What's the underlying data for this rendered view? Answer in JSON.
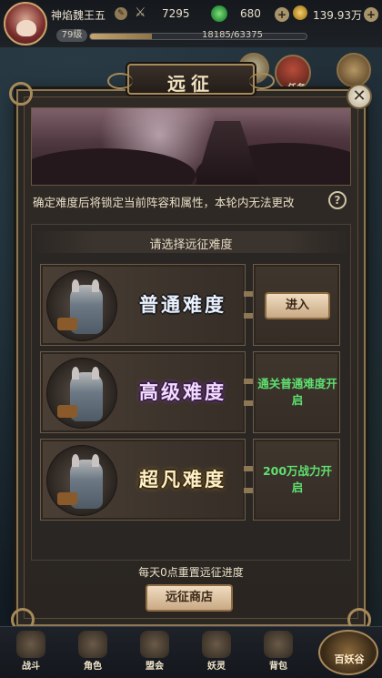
{
  "player": {
    "name": "神焰魏王五",
    "power": "7295",
    "jade": "680",
    "coins": "139.93万",
    "level": "79级",
    "exp_text": "18185/63375",
    "exp_fraction": 0.287
  },
  "side": {
    "quest_label": "任务"
  },
  "modal": {
    "title": "远征",
    "notice": "确定难度后将锁定当前阵容和属性，本轮内无法更改",
    "help": "?",
    "select_title": "请选择远征难度",
    "difficulties": [
      {
        "name": "普通难度",
        "action_label": "进入",
        "locked_text": ""
      },
      {
        "name": "高级难度",
        "action_label": "",
        "locked_text": "通关普通难度开启"
      },
      {
        "name": "超凡难度",
        "action_label": "",
        "locked_text": "200万战力开启"
      }
    ],
    "reset_text": "每天0点重置远征进度",
    "shop_label": "远征商店"
  },
  "nav": {
    "items": [
      "战斗",
      "角色",
      "盟会",
      "妖灵",
      "背包"
    ],
    "big_label": "百妖谷"
  },
  "colors": {
    "unlock_green": "#5fe070",
    "frame_gold": "#a78a5a"
  }
}
